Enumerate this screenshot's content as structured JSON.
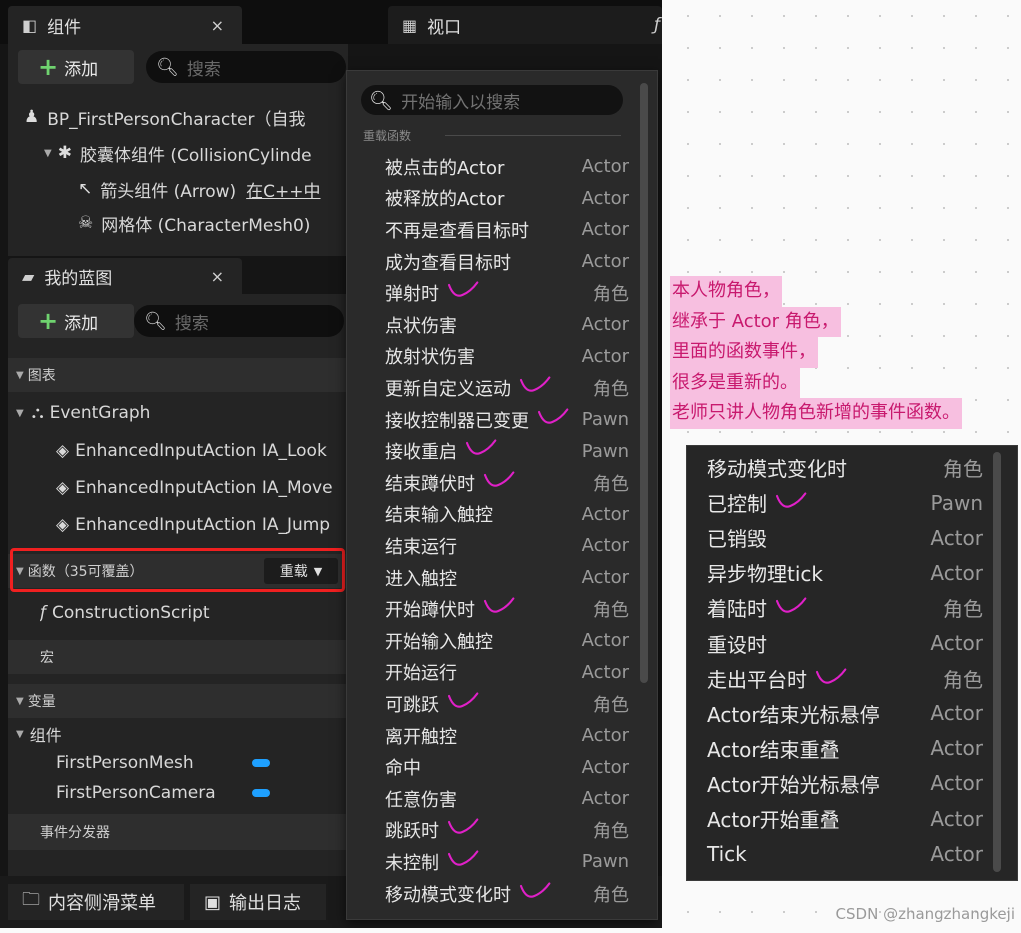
{
  "tabs": {
    "components_title": "组件",
    "viewport_title": "视口",
    "close_glyph": "×",
    "viewport_extra_glyph": "ƒ"
  },
  "components_panel": {
    "add_label": "添加",
    "search_placeholder": "搜索",
    "tree": [
      "BP_FirstPersonCharacter（自我",
      "胶囊体组件 (CollisionCylinde",
      "箭头组件 (Arrow)",
      "网格体 (CharacterMesh0)"
    ],
    "arrow_link": "在C++中"
  },
  "blueprint_panel": {
    "title": "我的蓝图",
    "add_label": "添加",
    "search_placeholder": "搜索",
    "graphs_label": "图表",
    "event_graph": "EventGraph",
    "actions": [
      "EnhancedInputAction IA_Look",
      "EnhancedInputAction IA_Move",
      "EnhancedInputAction IA_Jump"
    ],
    "functions_label": "函数（35可覆盖）",
    "override_label": "重载",
    "construction_script": "ConstructionScript",
    "macros_label": "宏",
    "variables_label": "变量",
    "components_group": "组件",
    "vars": [
      "FirstPersonMesh",
      "FirstPersonCamera"
    ],
    "dispatchers_label": "事件分发器"
  },
  "popup": {
    "search_placeholder": "开始输入以搜索",
    "section": "重载函数",
    "items": [
      {
        "label": "被点击的Actor",
        "type": "Actor",
        "check": false
      },
      {
        "label": "被释放的Actor",
        "type": "Actor",
        "check": false
      },
      {
        "label": "不再是查看目标时",
        "type": "Actor",
        "check": false
      },
      {
        "label": "成为查看目标时",
        "type": "Actor",
        "check": false
      },
      {
        "label": "弹射时",
        "type": "角色",
        "check": true
      },
      {
        "label": "点状伤害",
        "type": "Actor",
        "check": false
      },
      {
        "label": "放射状伤害",
        "type": "Actor",
        "check": false
      },
      {
        "label": "更新自定义运动",
        "type": "角色",
        "check": true
      },
      {
        "label": "接收控制器已变更",
        "type": "Pawn",
        "check": true
      },
      {
        "label": "接收重启",
        "type": "Pawn",
        "check": true
      },
      {
        "label": "结束蹲伏时",
        "type": "角色",
        "check": true
      },
      {
        "label": "结束输入触控",
        "type": "Actor",
        "check": false
      },
      {
        "label": "结束运行",
        "type": "Actor",
        "check": false
      },
      {
        "label": "进入触控",
        "type": "Actor",
        "check": false
      },
      {
        "label": "开始蹲伏时",
        "type": "角色",
        "check": true
      },
      {
        "label": "开始输入触控",
        "type": "Actor",
        "check": false
      },
      {
        "label": "开始运行",
        "type": "Actor",
        "check": false
      },
      {
        "label": "可跳跃",
        "type": "角色",
        "check": true
      },
      {
        "label": "离开触控",
        "type": "Actor",
        "check": false
      },
      {
        "label": "命中",
        "type": "Actor",
        "check": false
      },
      {
        "label": "任意伤害",
        "type": "Actor",
        "check": false
      },
      {
        "label": "跳跃时",
        "type": "角色",
        "check": true
      },
      {
        "label": "未控制",
        "type": "Pawn",
        "check": true
      },
      {
        "label": "移动模式变化时",
        "type": "角色",
        "check": true
      }
    ]
  },
  "annotation": [
    "本人物角色，",
    "继承于 Actor 角色，",
    "里面的函数事件，",
    "很多是重新的。",
    "老师只讲人物角色新增的事件函数。"
  ],
  "right_panel": {
    "items": [
      {
        "label": "移动模式变化时",
        "type": "角色",
        "check": false
      },
      {
        "label": "已控制",
        "type": "Pawn",
        "check": true
      },
      {
        "label": "已销毁",
        "type": "Actor",
        "check": false
      },
      {
        "label": "异步物理tick",
        "type": "Actor",
        "check": false
      },
      {
        "label": "着陆时",
        "type": "角色",
        "check": true
      },
      {
        "label": "重设时",
        "type": "Actor",
        "check": false
      },
      {
        "label": "走出平台时",
        "type": "角色",
        "check": true
      },
      {
        "label": "Actor结束光标悬停",
        "type": "Actor",
        "check": false
      },
      {
        "label": "Actor结束重叠",
        "type": "Actor",
        "check": false
      },
      {
        "label": "Actor开始光标悬停",
        "type": "Actor",
        "check": false
      },
      {
        "label": "Actor开始重叠",
        "type": "Actor",
        "check": false
      },
      {
        "label": "Tick",
        "type": "Actor",
        "check": false
      }
    ]
  },
  "bottom": {
    "content_drawer": "内容侧滑菜单",
    "output_log": "输出日志"
  },
  "watermark": "CSDN @zhangzhangkeji",
  "colors": {
    "accent_check": "#e020c8",
    "annotation_bg": "#f7bfe0",
    "highlight_box": "#f02020",
    "var_pill": "#1ea0ff"
  }
}
